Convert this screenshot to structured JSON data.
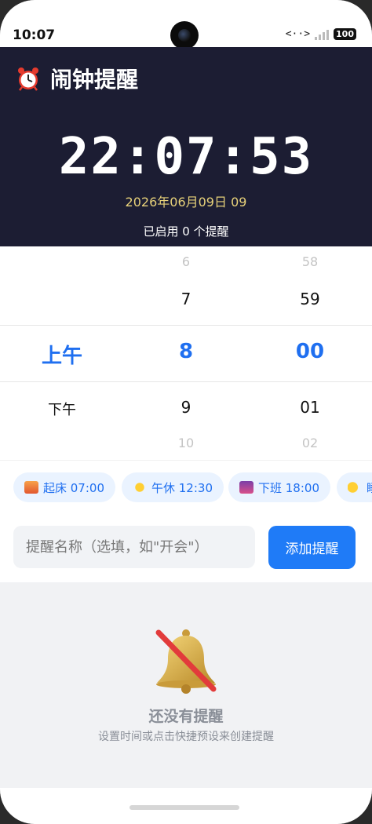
{
  "status_bar": {
    "time": "10:07",
    "network": "<··>",
    "battery": "100"
  },
  "header": {
    "title": "闹钟提醒",
    "clock": "22:07:53",
    "date": "2026年06月09日 09",
    "enabled_text": "已启用 0 个提醒"
  },
  "picker": {
    "ampm": {
      "selected": "上午",
      "next": "下午"
    },
    "hour": {
      "prev2": "6",
      "prev1": "7",
      "selected": "8",
      "next1": "9",
      "next2": "10"
    },
    "minute": {
      "prev2": "58",
      "prev1": "59",
      "selected": "00",
      "next1": "01",
      "next2": "02"
    }
  },
  "presets": [
    {
      "label": "起床 07:00",
      "icon": "sunrise-icon"
    },
    {
      "label": "午休 12:30",
      "icon": "sun-icon"
    },
    {
      "label": "下班 18:00",
      "icon": "city-dusk-icon"
    },
    {
      "label": "睡",
      "icon": "moon-icon"
    }
  ],
  "form": {
    "name_placeholder": "提醒名称（选填，如\"开会\"）",
    "add_button": "添加提醒"
  },
  "empty_state": {
    "title": "还没有提醒",
    "subtitle": "设置时间或点击快捷预设来创建提醒"
  },
  "colors": {
    "header_bg": "#1c1d33",
    "accent": "#1f7bf7",
    "date": "#e8d27a"
  }
}
